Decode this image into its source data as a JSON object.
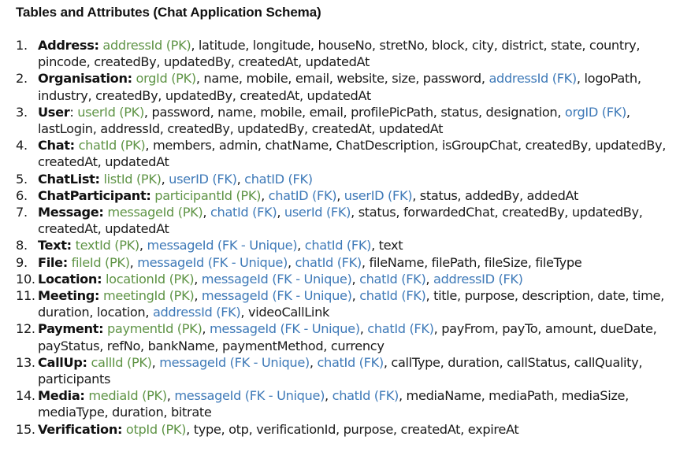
{
  "heading": "Tables and Attributes (Chat Application Schema)",
  "colors": {
    "pk": "#5f9446",
    "fk": "#3f7ab8",
    "text": "#1a1a1a"
  },
  "tables": [
    {
      "num": "1.",
      "name": "Address:",
      "parts": [
        {
          "t": "pk",
          "v": "addressId (PK)"
        },
        {
          "t": "plain",
          "v": ", latitude, longitude, houseNo, stretNo, block, city, district, state, country, pincode, createdBy, updatedBy, createdAt, updatedAt"
        }
      ]
    },
    {
      "num": "2.",
      "name": "Organisation:",
      "parts": [
        {
          "t": "pk",
          "v": "orgId (PK)"
        },
        {
          "t": "plain",
          "v": ", name, mobile, email, website, size, password, "
        },
        {
          "t": "fk",
          "v": "addressId (FK)"
        },
        {
          "t": "plain",
          "v": ", logoPath, industry, createdBy, updatedBy, createdAt, updatedAt"
        }
      ]
    },
    {
      "num": "3.",
      "name": "User",
      "parts": [
        {
          "t": "plain",
          "v": ": "
        },
        {
          "t": "pk",
          "v": "userId (PK)"
        },
        {
          "t": "plain",
          "v": ", password, name, mobile, email, profilePicPath, status, designation, "
        },
        {
          "t": "fk",
          "v": "orgID (FK)"
        },
        {
          "t": "plain",
          "v": ", lastLogin, addressId, createdBy, updatedBy, createdAt, updatedAt"
        }
      ]
    },
    {
      "num": "4.",
      "name": "Chat:",
      "parts": [
        {
          "t": "pk",
          "v": "chatId (PK)"
        },
        {
          "t": "plain",
          "v": ", members, admin, chatName, ChatDescription, isGroupChat, createdBy, updatedBy, createdAt, updatedAt"
        }
      ]
    },
    {
      "num": "5.",
      "name": "ChatList:",
      "parts": [
        {
          "t": "pk",
          "v": "listId (PK)"
        },
        {
          "t": "plain",
          "v": ", "
        },
        {
          "t": "fk",
          "v": "userID (FK)"
        },
        {
          "t": "plain",
          "v": ", "
        },
        {
          "t": "fk",
          "v": "chatID (FK)"
        }
      ]
    },
    {
      "num": "6.",
      "name": "ChatParticipant:",
      "parts": [
        {
          "t": "pk",
          "v": "participantId (PK)"
        },
        {
          "t": "plain",
          "v": ", "
        },
        {
          "t": "fk",
          "v": "chatID (FK)"
        },
        {
          "t": "plain",
          "v": ", "
        },
        {
          "t": "fk",
          "v": "userID (FK)"
        },
        {
          "t": "plain",
          "v": ", status, addedBy, addedAt"
        }
      ]
    },
    {
      "num": "7.",
      "name": "Message:",
      "parts": [
        {
          "t": "pk",
          "v": "messageId (PK)"
        },
        {
          "t": "plain",
          "v": ", "
        },
        {
          "t": "fk",
          "v": "chatId (FK)"
        },
        {
          "t": "plain",
          "v": ", "
        },
        {
          "t": "fk",
          "v": "userId (FK)"
        },
        {
          "t": "plain",
          "v": ", status, forwardedChat, createdBy, updatedBy, createdAt, updatedAt"
        }
      ]
    },
    {
      "num": "8.",
      "name": "Text:",
      "parts": [
        {
          "t": "pk",
          "v": "textId (PK)"
        },
        {
          "t": "plain",
          "v": ", "
        },
        {
          "t": "fk",
          "v": "messageId (FK - Unique)"
        },
        {
          "t": "plain",
          "v": ", "
        },
        {
          "t": "fk",
          "v": "chatId (FK)"
        },
        {
          "t": "plain",
          "v": ", text"
        }
      ]
    },
    {
      "num": "9.",
      "name": "File:",
      "parts": [
        {
          "t": "pk",
          "v": "fileId (PK)"
        },
        {
          "t": "plain",
          "v": ", "
        },
        {
          "t": "fk",
          "v": "messageId (FK - Unique)"
        },
        {
          "t": "plain",
          "v": ", "
        },
        {
          "t": "fk",
          "v": "chatId (FK)"
        },
        {
          "t": "plain",
          "v": ", fileName, filePath, fileSize, fileType"
        }
      ]
    },
    {
      "num": "10.",
      "name": "Location:",
      "parts": [
        {
          "t": "pk",
          "v": "locationId (PK)"
        },
        {
          "t": "plain",
          "v": ", "
        },
        {
          "t": "fk",
          "v": "messageId (FK - Unique)"
        },
        {
          "t": "plain",
          "v": ", "
        },
        {
          "t": "fk",
          "v": "chatId (FK)"
        },
        {
          "t": "plain",
          "v": ", "
        },
        {
          "t": "fk",
          "v": "addressID (FK)"
        }
      ]
    },
    {
      "num": "11.",
      "name": "Meeting:",
      "parts": [
        {
          "t": "pk",
          "v": "meetingId (PK)"
        },
        {
          "t": "plain",
          "v": ", "
        },
        {
          "t": "fk",
          "v": "messageId (FK - Unique)"
        },
        {
          "t": "plain",
          "v": ", "
        },
        {
          "t": "fk",
          "v": "chatId (FK)"
        },
        {
          "t": "plain",
          "v": ", title, purpose, description, date, time, duration, location, "
        },
        {
          "t": "fk",
          "v": "addressId (FK)"
        },
        {
          "t": "plain",
          "v": ", videoCallLink"
        }
      ]
    },
    {
      "num": "12.",
      "name": "Payment:",
      "parts": [
        {
          "t": "pk",
          "v": "paymentId (PK)"
        },
        {
          "t": "plain",
          "v": ", "
        },
        {
          "t": "fk",
          "v": "messageId (FK - Unique)"
        },
        {
          "t": "plain",
          "v": ", "
        },
        {
          "t": "fk",
          "v": "chatId (FK)"
        },
        {
          "t": "plain",
          "v": ", payFrom, payTo, amount, dueDate, payStatus, refNo, bankName, paymentMethod, currency"
        }
      ]
    },
    {
      "num": "13.",
      "name": "CallUp:",
      "parts": [
        {
          "t": "pk",
          "v": "callId (PK)"
        },
        {
          "t": "plain",
          "v": ", "
        },
        {
          "t": "fk",
          "v": "messageId (FK - Unique)"
        },
        {
          "t": "plain",
          "v": ", "
        },
        {
          "t": "fk",
          "v": "chatId (FK)"
        },
        {
          "t": "plain",
          "v": ", callType, duration, callStatus, callQuality, participants"
        }
      ]
    },
    {
      "num": "14.",
      "name": "Media:",
      "parts": [
        {
          "t": "pk",
          "v": "mediaId (PK)"
        },
        {
          "t": "plain",
          "v": ", "
        },
        {
          "t": "fk",
          "v": "messageId (FK - Unique)"
        },
        {
          "t": "plain",
          "v": ", "
        },
        {
          "t": "fk",
          "v": "chatId (FK)"
        },
        {
          "t": "plain",
          "v": ", mediaName, mediaPath, mediaSize, mediaType, duration, bitrate"
        }
      ]
    },
    {
      "num": "15.",
      "name": "Verification:",
      "parts": [
        {
          "t": "pk",
          "v": "otpId (PK)"
        },
        {
          "t": "plain",
          "v": ", type, otp, verificationId, purpose, createdAt, expireAt"
        }
      ]
    }
  ]
}
